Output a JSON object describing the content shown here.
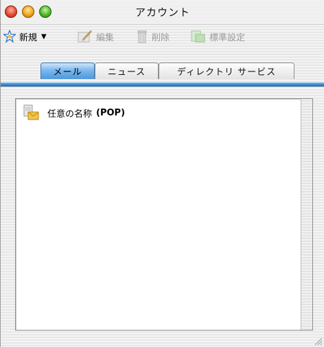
{
  "window": {
    "title": "アカウント"
  },
  "toolbar": {
    "new_label": "新規",
    "edit_label": "編集",
    "delete_label": "削除",
    "default_label": "標準設定"
  },
  "tabs": [
    {
      "label": "メール",
      "active": true
    },
    {
      "label": "ニュース",
      "active": false
    },
    {
      "label": "ディレクトリ サービス",
      "active": false
    }
  ],
  "accounts": [
    {
      "name": "任意の名称",
      "type": "(POP)"
    }
  ],
  "colors": {
    "tab_accent": "#4d97dc",
    "list_bg": "#ffffff"
  }
}
